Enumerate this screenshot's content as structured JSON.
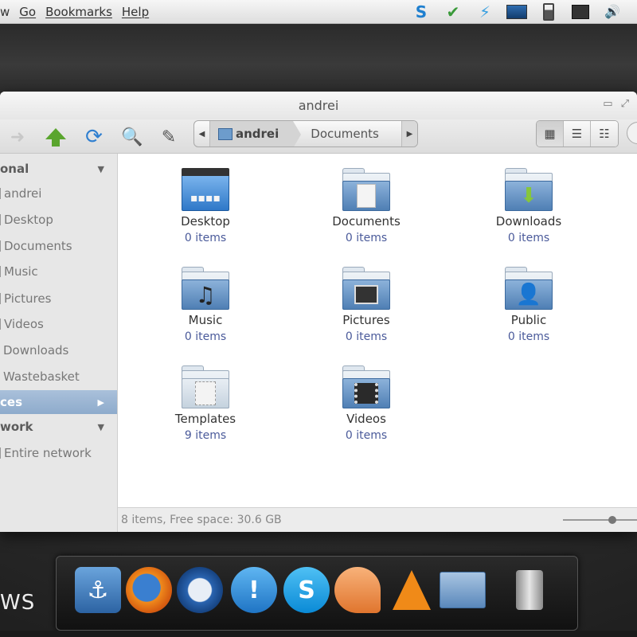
{
  "menubar": {
    "items": [
      "w",
      "Go",
      "Bookmarks",
      "Help"
    ]
  },
  "tray": {
    "icons": [
      "skype-status-icon",
      "shield-icon",
      "lightning-icon",
      "monitor-icon",
      "battery-icon",
      "network-icon",
      "volume-icon"
    ]
  },
  "window": {
    "title": "andrei"
  },
  "pathbar": {
    "segments": [
      "andrei",
      "Documents"
    ]
  },
  "sidebar": {
    "personal_label": "onal",
    "personal_items": [
      "andrei",
      "Desktop",
      "Documents",
      "Music",
      "Pictures",
      "Videos",
      "Downloads",
      "Wastebasket"
    ],
    "places_label": "ces",
    "network_label": "work",
    "network_items": [
      "Entire network"
    ]
  },
  "content": {
    "items": [
      {
        "name": "Desktop",
        "count": "0 items",
        "emblem": "desktop"
      },
      {
        "name": "Documents",
        "count": "0 items",
        "emblem": "document"
      },
      {
        "name": "Downloads",
        "count": "0 items",
        "emblem": "download-arrow"
      },
      {
        "name": "Music",
        "count": "0 items",
        "emblem": "music-note"
      },
      {
        "name": "Pictures",
        "count": "0 items",
        "emblem": "camera"
      },
      {
        "name": "Public",
        "count": "0 items",
        "emblem": "person"
      },
      {
        "name": "Templates",
        "count": "9 items",
        "emblem": "template"
      },
      {
        "name": "Videos",
        "count": "0 items",
        "emblem": "film"
      }
    ]
  },
  "statusbar": {
    "text": "8 items, Free space: 30.6 GB"
  },
  "dock": {
    "label": "WS",
    "apps": [
      "anchor-app-icon",
      "firefox-icon",
      "thunderbird-icon",
      "chat-icon",
      "skype-icon",
      "slice-app-icon",
      "vlc-icon",
      "folder-icon",
      "trash-icon"
    ]
  }
}
